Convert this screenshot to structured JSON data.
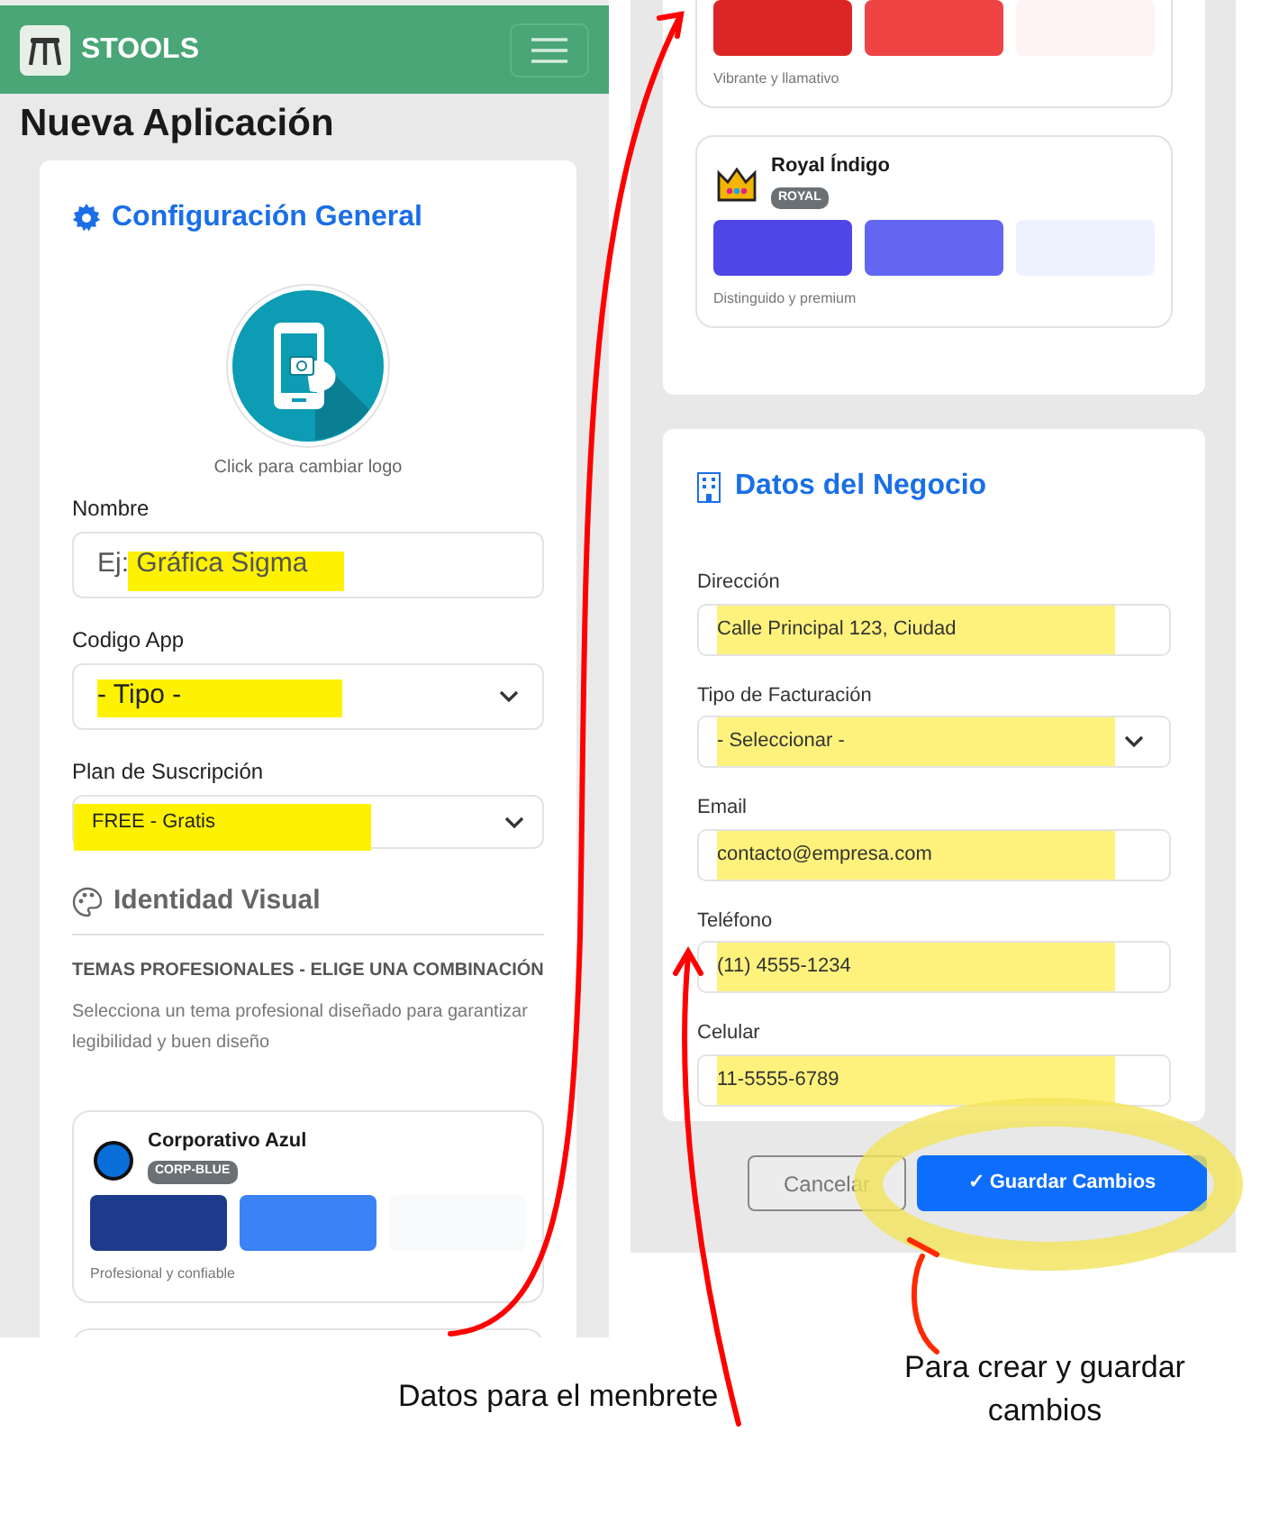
{
  "left_screen": {
    "app_name": "STOOLS",
    "page_title": "Nueva Aplicación",
    "section_title": "Configuración General",
    "logo_caption": "Click para cambiar logo",
    "fields": [
      {
        "kind": "input",
        "label": "Nombre",
        "placeholder": "Ej: Gráfica Sigma",
        "highlighted": true
      },
      {
        "kind": "select",
        "label": "Codigo App",
        "value": "- Tipo -",
        "highlighted": true
      },
      {
        "kind": "select",
        "label": "Plan de Suscripción",
        "value": "FREE - Gratis",
        "highlighted": true
      }
    ],
    "identity_title": "Identidad Visual",
    "themes_heading": "TEMAS PROFESIONALES - ELIGE UNA COMBINACIÓN",
    "themes_description": "Selecciona un tema profesional diseñado para garantizar legibilidad y buen diseño",
    "themes": [
      {
        "kind": "dot",
        "color": "#0a6fd8",
        "name": "Corporativo Azul",
        "code": "CORP-BLUE",
        "swatches": [
          {
            "color": "#1e3a8a"
          },
          {
            "color": "#3b82f6"
          },
          {
            "color": "#f8fafc"
          }
        ],
        "caption": "Profesional y confiable"
      }
    ]
  },
  "right_screen": {
    "themes": [
      {
        "kind": "cut",
        "swatches": [
          {
            "color": "#dc2626"
          },
          {
            "color": "#ef4444"
          },
          {
            "color": "#fef2f2"
          }
        ],
        "caption": "Vibrante y llamativo"
      },
      {
        "kind": "crown",
        "name": "Royal Índigo",
        "code": "ROYAL",
        "swatches": [
          {
            "color": "#4f46e5"
          },
          {
            "color": "#6366f1"
          },
          {
            "color": "#eef2ff"
          }
        ],
        "caption": "Distinguido y premium"
      }
    ],
    "section_title": "Datos del Negocio",
    "fields": [
      {
        "kind": "input",
        "label": "Dirección",
        "value": "Calle Principal 123, Ciudad",
        "highlighted": true
      },
      {
        "kind": "select",
        "label": "Tipo de Facturación",
        "value": "- Seleccionar -",
        "highlighted": true
      },
      {
        "kind": "input",
        "label": "Email",
        "value": "contacto@empresa.com",
        "highlighted": true
      },
      {
        "kind": "input",
        "label": "Teléfono",
        "value": "(11) 4555-1234",
        "highlighted": true
      },
      {
        "kind": "input",
        "label": "Celular",
        "value": "11-5555-6789",
        "highlighted": true
      }
    ],
    "cancel_button": "Cancelar",
    "save_button": "✓ Guardar Cambios"
  },
  "notes": [
    "Datos para el menbrete",
    "Para crear y guardar cambios"
  ]
}
